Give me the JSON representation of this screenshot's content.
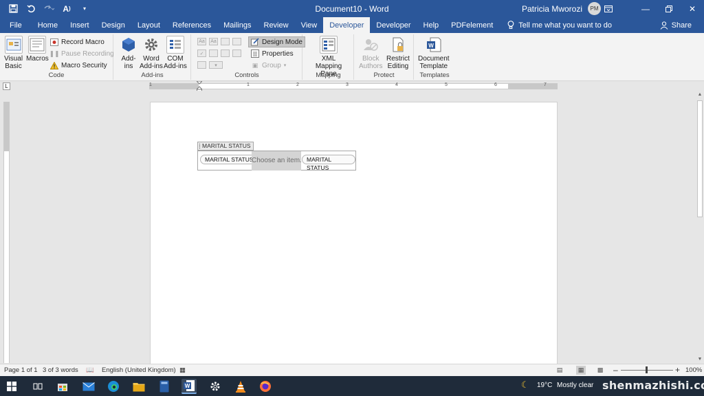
{
  "window": {
    "title": "Document10 - Word",
    "user_name": "Patricia Mworozi",
    "user_initials": "PM",
    "accent": "#2b579a"
  },
  "qat": {
    "save_icon": "save-icon",
    "undo_icon": "undo-icon",
    "redo_icon": "redo-icon",
    "read_aloud_icon": "read-aloud-icon",
    "customize_icon": "customize-qat-icon"
  },
  "tabs": [
    {
      "label": "File"
    },
    {
      "label": "Home"
    },
    {
      "label": "Insert"
    },
    {
      "label": "Design"
    },
    {
      "label": "Layout"
    },
    {
      "label": "References"
    },
    {
      "label": "Mailings"
    },
    {
      "label": "Review"
    },
    {
      "label": "View"
    },
    {
      "label": "Developer",
      "active": true
    },
    {
      "label": "Developer"
    },
    {
      "label": "Help"
    },
    {
      "label": "PDFelement"
    }
  ],
  "tellme": "Tell me what you want to do",
  "share": "Share",
  "ribbon": {
    "code": {
      "label": "Code",
      "visual_basic": "Visual Basic",
      "visual_basic_l1": "Visual",
      "visual_basic_l2": "Basic",
      "macros": "Macros",
      "record_macro": "Record Macro",
      "pause_recording": "Pause Recording",
      "macro_security": "Macro Security"
    },
    "addins": {
      "label": "Add-ins",
      "addins_l1": "Add-",
      "addins_l2": "ins",
      "word_l1": "Word",
      "word_l2": "Add-ins",
      "com_l1": "COM",
      "com_l2": "Add-ins"
    },
    "controls": {
      "label": "Controls",
      "design_mode": "Design Mode",
      "properties": "Properties",
      "group": "Group"
    },
    "mapping": {
      "label": "Mapping",
      "xml_l1": "XML Mapping",
      "xml_l2": "Pane"
    },
    "protect": {
      "label": "Protect",
      "block_l1": "Block",
      "block_l2": "Authors",
      "restrict_l1": "Restrict",
      "restrict_l2": "Editing"
    },
    "templates": {
      "label": "Templates",
      "doc_l1": "Document",
      "doc_l2": "Template"
    }
  },
  "ruler": {
    "numbers": [
      "1",
      "1",
      "2",
      "3",
      "4",
      "5",
      "6",
      "7"
    ]
  },
  "document": {
    "content_control": {
      "tag": "MARITAL STATUS",
      "start_label": "MARITAL STATUS",
      "placeholder": "Choose an item.",
      "end_label": "MARITAL STATUS"
    }
  },
  "statusbar": {
    "page": "Page 1 of 1",
    "words": "3 of 3 words",
    "language": "English (United Kingdom)",
    "zoom": "100%"
  },
  "taskbar": {
    "weather_temp": "19°C",
    "weather_desc": "Mostly clear",
    "watermark": "shenmazhishi.com"
  }
}
